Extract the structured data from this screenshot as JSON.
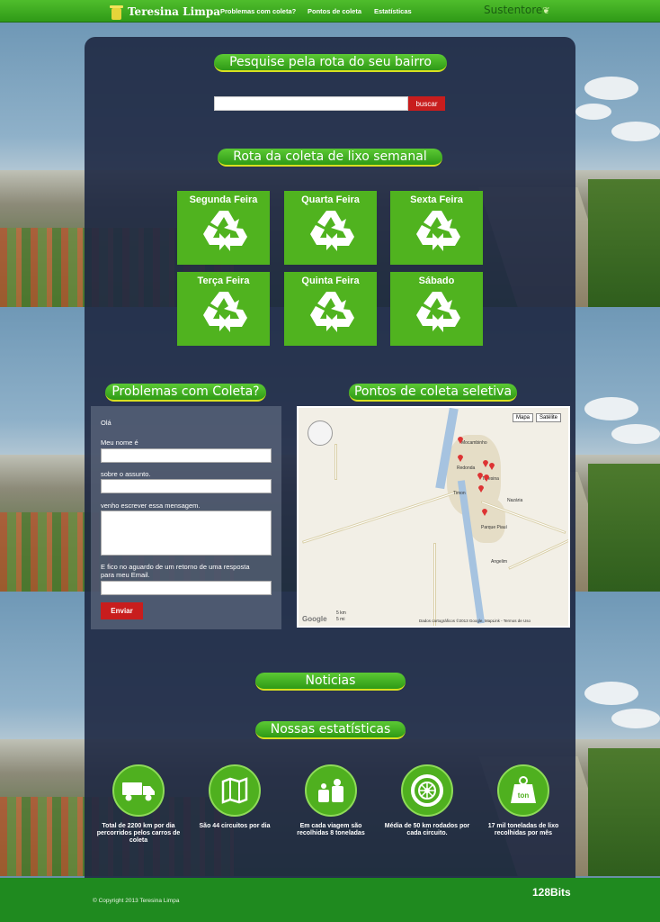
{
  "header": {
    "logo_text": "Teresina Limpa",
    "nav": [
      "Problemas com coleta?",
      "Pontos de coleta",
      "Estatísticas"
    ],
    "partner": "Sustentore"
  },
  "search": {
    "title": "Pesquise pela rota do seu bairro",
    "placeholder": "",
    "button_label": "buscar"
  },
  "schedule": {
    "title": "Rota da coleta de lixo semanal",
    "days": [
      "Segunda Feira",
      "Quarta Feira",
      "Sexta Feira",
      "Terça Feira",
      "Quinta Feira",
      "Sábado"
    ]
  },
  "contact": {
    "title": "Problemas com Coleta?",
    "greeting": "Olá",
    "name_label": "Meu nome é",
    "subject_label": "sobre o assunto.",
    "message_label": "venho escrever essa mensagem.",
    "reply_label": "E fico no aguardo de um retorno de uma resposta para meu Email.",
    "send_label": "Enviar"
  },
  "map": {
    "title": "Pontos de coleta seletiva",
    "toggle_map": "Mapa",
    "toggle_satellite": "Satélite",
    "towns": [
      "Nazária",
      "Teresina",
      "Timon",
      "Parque Piauí",
      "Angelim",
      "Mocambinho",
      "Redonda"
    ],
    "attribution": "Dados cartográficos ©2013 Google, MapLink - Termos de Uso",
    "scale_km": "5 km",
    "scale_mi": "5 mi",
    "google": "Google"
  },
  "news": {
    "title": "Noticias"
  },
  "stats": {
    "title": "Nossas estatísticas",
    "items": [
      {
        "icon": "truck-icon",
        "text": "Total de 2200 km por dia percorridos pelos carros de coleta"
      },
      {
        "icon": "map-icon",
        "text": "São 44 circuitos por dia"
      },
      {
        "icon": "trash-bags-icon",
        "text": "Em cada viagem são recolhidas 8 toneladas"
      },
      {
        "icon": "tire-icon",
        "text": "Média de 50 km rodados por cada circuito."
      },
      {
        "icon": "weight-icon",
        "text": "17 mil toneladas de lixo recolhidas por mês"
      }
    ],
    "weight_icon_label": "ton"
  },
  "footer": {
    "copyright": "© Copyright 2013 Teresina Limpa",
    "brand": "128Bits"
  },
  "colors": {
    "green": "#50b31f",
    "red": "#c81d1d",
    "panel": "#1e2842"
  }
}
